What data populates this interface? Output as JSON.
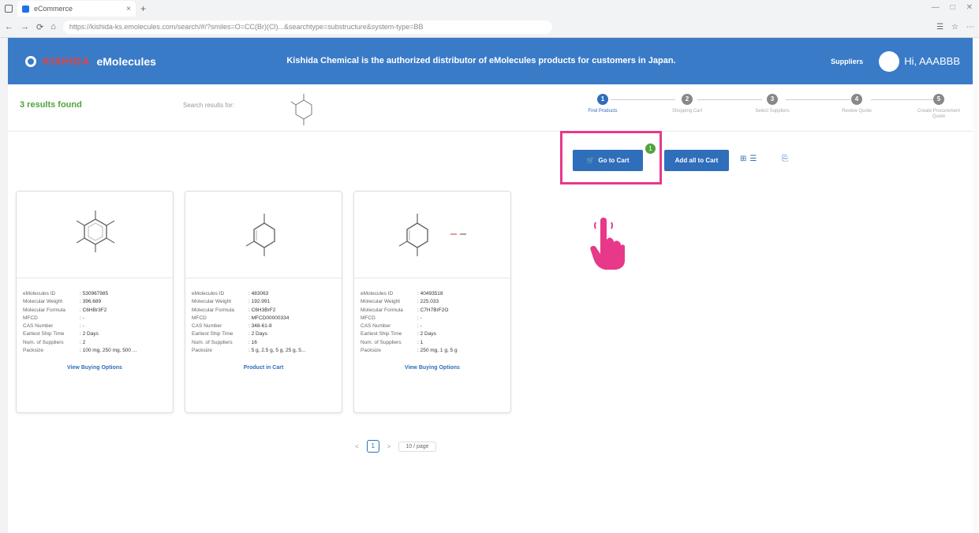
{
  "browser": {
    "tab_title": "eCommerce",
    "tab_close": "×",
    "new_tab": "+",
    "url": "https://kishida-ks.emolecules.com/search/#/?smiles=O=CC(Br)(Cl)...&searchtype=substructure&system-type=BB",
    "nav": {
      "back": "←",
      "forward": "→",
      "refresh": "⟳",
      "home": "⌂"
    },
    "window_controls": {
      "minimize": "—",
      "maximize": "□",
      "close": "✕"
    },
    "extension_icons": [
      "☰",
      "☆",
      "⋯"
    ]
  },
  "header": {
    "brand": "KISHIDA",
    "product": "eMolecules",
    "banner": "Kishida Chemical is the authorized distributor of eMolecules products for customers in Japan.",
    "supplier_link": "Suppliers",
    "greeting": "Hi, AAABBB"
  },
  "results": {
    "count_text": "3 results found",
    "search_label": "Search results for:"
  },
  "steps": [
    {
      "num": "1",
      "label": "Find Products",
      "active": true
    },
    {
      "num": "2",
      "label": "Shopping Cart",
      "active": false
    },
    {
      "num": "3",
      "label": "Select Suppliers",
      "active": false
    },
    {
      "num": "4",
      "label": "Review Quote",
      "active": false
    },
    {
      "num": "5",
      "label": "Create Procurement Quote",
      "active": false
    }
  ],
  "toolbar": {
    "goto_cart": "Go to Cart",
    "cart_badge": "1",
    "add_all": "Add all to Cart",
    "grid_icon": "⊞",
    "list_icon": "☰",
    "export_icon": "⎘"
  },
  "cards": [
    {
      "rows": [
        {
          "key": "eMolecules ID",
          "val": ": 530967985"
        },
        {
          "key": "Molecular Weight",
          "val": ": 396.689"
        },
        {
          "key": "Molecular Formula",
          "val": ": C6HBr3F2"
        },
        {
          "key": "MFCD",
          "val": ": -"
        },
        {
          "key": "CAS Number",
          "val": ": -"
        },
        {
          "key": "Earliest Ship Time",
          "val": ": 2 Days"
        },
        {
          "key": "Num. of Suppliers",
          "val": ": 2"
        },
        {
          "key": "Packsize",
          "val": ": 100 mg, 250 mg, 500 ..."
        }
      ],
      "link": "View Buying Options"
    },
    {
      "rows": [
        {
          "key": "eMolecules ID",
          "val": ": 483063"
        },
        {
          "key": "Molecular Weight",
          "val": ": 192.991"
        },
        {
          "key": "Molecular Formula",
          "val": ": C6H3BrF2"
        },
        {
          "key": "MFCD",
          "val": ": MFCD00000334"
        },
        {
          "key": "CAS Number",
          "val": ": 348-61-8"
        },
        {
          "key": "Earliest Ship Time",
          "val": ": 2 Days"
        },
        {
          "key": "Num. of Suppliers",
          "val": ": 16"
        },
        {
          "key": "Packsize",
          "val": ": 5 g, 2.5 g, 5 g, 25 g, 5..."
        }
      ],
      "link": "Product in Cart"
    },
    {
      "rows": [
        {
          "key": "eMolecules ID",
          "val": ": 40493518"
        },
        {
          "key": "Molecular Weight",
          "val": ": 225.033"
        },
        {
          "key": "Molecular Formula",
          "val": ": C7H7BrF2O"
        },
        {
          "key": "MFCD",
          "val": ": -"
        },
        {
          "key": "CAS Number",
          "val": ": -"
        },
        {
          "key": "Earliest Ship Time",
          "val": ": 2 Days"
        },
        {
          "key": "Num. of Suppliers",
          "val": ": 1"
        },
        {
          "key": "Packsize",
          "val": ": 250 mg, 1 g, 5 g"
        }
      ],
      "link": "View Buying Options"
    }
  ],
  "pagination": {
    "prev": "<",
    "current": "1",
    "next": ">",
    "page_size": "10 / page"
  },
  "colors": {
    "header_blue": "#3a7bc8",
    "button_blue": "#2f6eba",
    "highlight_pink": "#e8388a",
    "success_green": "#52a33c"
  }
}
